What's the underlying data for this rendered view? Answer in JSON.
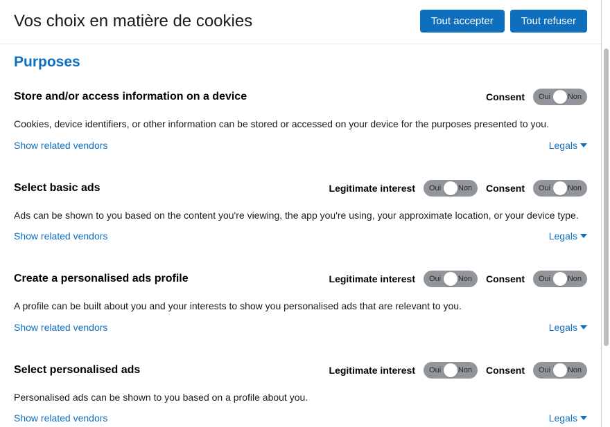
{
  "header": {
    "title": "Vos choix en matière de cookies",
    "accept_all": "Tout accepter",
    "refuse_all": "Tout refuser"
  },
  "section_title": "Purposes",
  "labels": {
    "consent": "Consent",
    "legit": "Legitimate interest",
    "toggle_on": "Oui",
    "toggle_off": "Non",
    "show_vendors": "Show related vendors",
    "legals": "Legals"
  },
  "purposes": [
    {
      "title": "Store and/or access information on a device",
      "desc": "Cookies, device identifiers, or other information can be stored or accessed on your device for the purposes presented to you.",
      "has_legit": false
    },
    {
      "title": "Select basic ads",
      "desc": "Ads can be shown to you based on the content you're viewing, the app you're using, your approximate location, or your device type.",
      "has_legit": true
    },
    {
      "title": "Create a personalised ads profile",
      "desc": "A profile can be built about you and your interests to show you personalised ads that are relevant to you.",
      "has_legit": true
    },
    {
      "title": "Select personalised ads",
      "desc": "Personalised ads can be shown to you based on a profile about you.",
      "has_legit": true
    }
  ]
}
